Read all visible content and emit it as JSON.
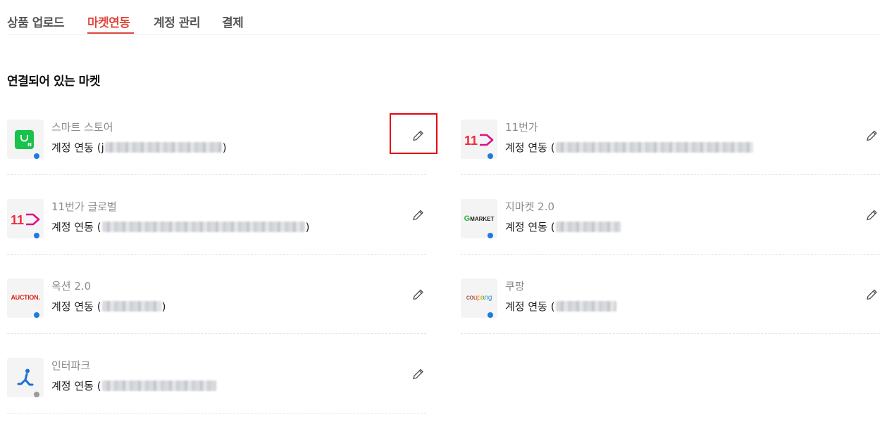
{
  "tabs": [
    {
      "label": "상품 업로드",
      "active": false
    },
    {
      "label": "마켓연동",
      "active": true
    },
    {
      "label": "계정 관리",
      "active": false
    },
    {
      "label": "결제",
      "active": false
    }
  ],
  "accent_color": "#e0483d",
  "section_title": "연결되어 있는 마켓",
  "markets": [
    {
      "name": "스마트 스토어",
      "account_prefix": "계정 연동 (",
      "account_visible_char": "j",
      "account_suffix": ")",
      "logo": "smartstore-logo",
      "status": "connected",
      "status_color": "#1f7ae0",
      "edit_icon": "pencil-icon"
    },
    {
      "name": "11번가",
      "account_prefix": "계정 연동 (",
      "account_visible_char": "",
      "account_suffix": "",
      "logo": "11st-logo",
      "status": "connected",
      "status_color": "#1f7ae0",
      "edit_icon": "pencil-icon"
    },
    {
      "name": "11번가 글로벌",
      "account_prefix": "계정 연동 (",
      "account_visible_char": "",
      "account_suffix": ")",
      "logo": "11st-logo",
      "status": "connected",
      "status_color": "#1f7ae0",
      "edit_icon": "pencil-icon"
    },
    {
      "name": "지마켓 2.0",
      "account_prefix": "계정 연동 (",
      "account_visible_char": "",
      "account_suffix": "",
      "logo": "gmarket-logo",
      "logo_text_prefix": "G",
      "logo_text": "MARKET",
      "status": "connected",
      "status_color": "#1f7ae0",
      "edit_icon": "pencil-icon"
    },
    {
      "name": "옥션 2.0",
      "account_prefix": "계정 연동 (",
      "account_visible_char": "",
      "account_suffix": ")",
      "logo": "auction-logo",
      "logo_text": "AUCTION.",
      "status": "connected",
      "status_color": "#1f7ae0",
      "edit_icon": "pencil-icon"
    },
    {
      "name": "쿠팡",
      "account_prefix": "계정 연동 (",
      "account_visible_char": "",
      "account_suffix": "",
      "logo": "coupang-logo",
      "logo_text": "coupang",
      "status": "connected",
      "status_color": "#1f7ae0",
      "edit_icon": "pencil-icon"
    },
    {
      "name": "인터파크",
      "account_prefix": "계정 연동 (",
      "account_visible_char": "",
      "account_suffix": "",
      "logo": "interpark-logo",
      "status": "disconnected",
      "status_color": "#9a9a9a",
      "edit_icon": "pencil-icon"
    }
  ]
}
